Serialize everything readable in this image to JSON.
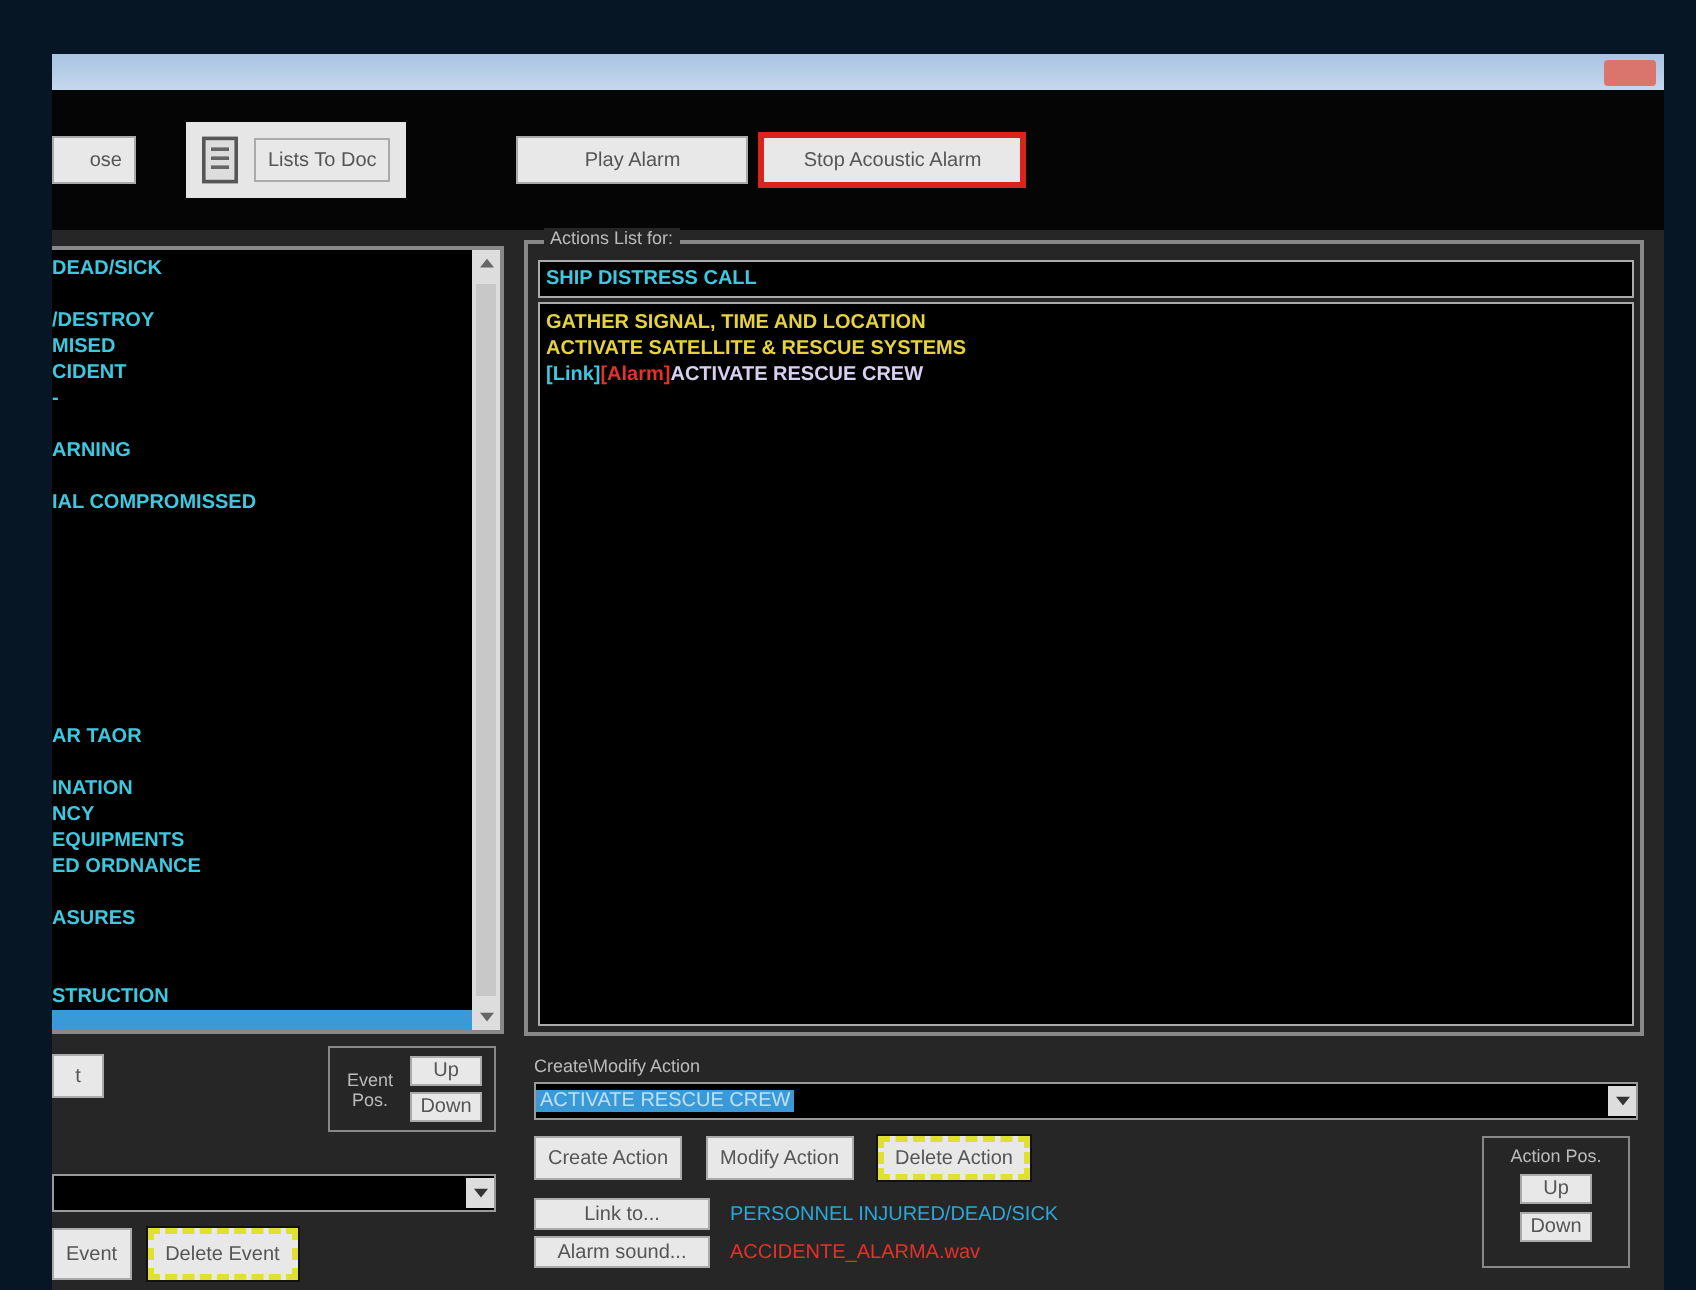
{
  "toolbar": {
    "buttons": [
      {
        "label": "ose",
        "kind": "plain"
      },
      {
        "label": "Lists To Doc",
        "kind": "doc"
      },
      {
        "label": "Play Alarm",
        "kind": "plain"
      },
      {
        "label": "Stop Acoustic Alarm",
        "kind": "alert"
      }
    ]
  },
  "events": {
    "rows": [
      {
        "kind": "item",
        "text": "DEAD/SICK",
        "selected": false
      },
      {
        "kind": "blank"
      },
      {
        "kind": "item",
        "text": "/DESTROY",
        "selected": false
      },
      {
        "kind": "item",
        "text": "MISED",
        "selected": false
      },
      {
        "kind": "item",
        "text": "CIDENT",
        "selected": false
      },
      {
        "kind": "item",
        "text": "-",
        "selected": false
      },
      {
        "kind": "blank"
      },
      {
        "kind": "item",
        "text": "ARNING",
        "selected": false
      },
      {
        "kind": "blank"
      },
      {
        "kind": "item",
        "text": "IAL COMPROMISSED",
        "selected": false
      },
      {
        "kind": "blank"
      },
      {
        "kind": "blank"
      },
      {
        "kind": "blank"
      },
      {
        "kind": "blank"
      },
      {
        "kind": "blank"
      },
      {
        "kind": "blank"
      },
      {
        "kind": "blank"
      },
      {
        "kind": "blank"
      },
      {
        "kind": "item",
        "text": "AR TAOR",
        "selected": false
      },
      {
        "kind": "blank"
      },
      {
        "kind": "item",
        "text": "INATION",
        "selected": false
      },
      {
        "kind": "item",
        "text": "NCY",
        "selected": false
      },
      {
        "kind": "item",
        "text": "EQUIPMENTS",
        "selected": false
      },
      {
        "kind": "item",
        "text": "ED ORDNANCE",
        "selected": false
      },
      {
        "kind": "blank"
      },
      {
        "kind": "item",
        "text": "ASURES",
        "selected": false
      },
      {
        "kind": "blank"
      },
      {
        "kind": "blank"
      },
      {
        "kind": "item",
        "text": "STRUCTION",
        "selected": false
      },
      {
        "kind": "item",
        "selected": true
      }
    ],
    "cut_button": "t",
    "pos_label": "Event Pos.",
    "up": "Up",
    "down": "Down",
    "buttons": [
      {
        "label": "Event",
        "kind": "plain"
      },
      {
        "label": "Delete Event",
        "kind": "hazard"
      }
    ]
  },
  "actions": {
    "group_title": "Actions List for:",
    "event_name": "SHIP DISTRESS CALL",
    "lines": [
      {
        "segments": [
          {
            "kind": "action",
            "text": "GATHER SIGNAL, TIME AND LOCATION"
          }
        ]
      },
      {
        "segments": [
          {
            "kind": "action",
            "text": "ACTIVATE SATELLITE & RESCUE SYSTEMS"
          }
        ]
      },
      {
        "segments": [
          {
            "kind": "link",
            "text": "[Link]"
          },
          {
            "kind": "alarm",
            "text": "[Alarm]"
          },
          {
            "kind": "linked_action",
            "text": "ACTIVATE RESCUE CREW"
          }
        ]
      }
    ],
    "edit_label": "Create\\Modify Action",
    "edit_value": "ACTIVATE RESCUE CREW",
    "buttons": [
      {
        "label": "Create Action",
        "kind": "plain"
      },
      {
        "label": "Modify Action",
        "kind": "plain"
      },
      {
        "label": "Delete Action",
        "kind": "hazard"
      }
    ],
    "link_button": "Link to...",
    "link_value": "PERSONNEL INJURED/DEAD/SICK",
    "alarm_button": "Alarm sound...",
    "alarm_value": "ACCIDENTE_ALARMA.wav",
    "pos_label": "Action Pos.",
    "up": "Up",
    "down": "Down"
  }
}
